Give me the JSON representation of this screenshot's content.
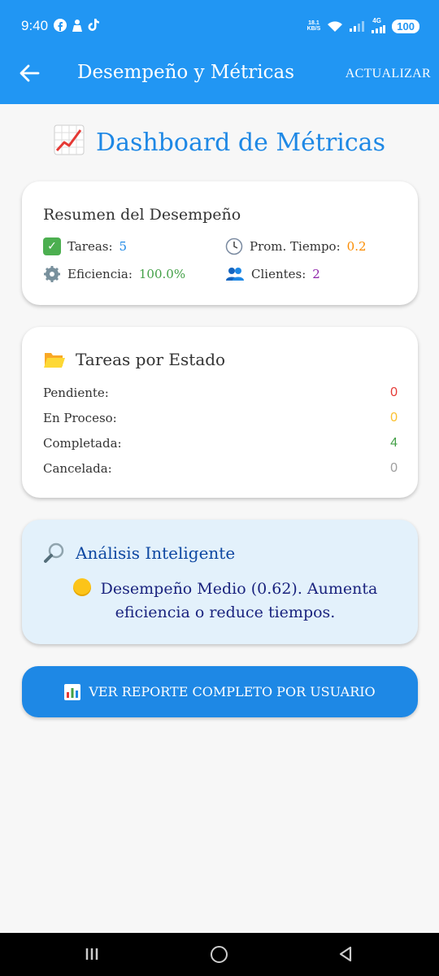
{
  "status_bar": {
    "time": "9:40",
    "speed_top": "18.1",
    "speed_bottom": "KB/S",
    "network": "4G",
    "battery": "100"
  },
  "appbar": {
    "title": "Desempeño y Métricas",
    "action": "ACTUALIZAR"
  },
  "header": {
    "emoji": "📈",
    "title": "Dashboard de Métricas"
  },
  "summary": {
    "title": "Resumen del Desempeño",
    "tareas_label": "Tareas:",
    "tareas_value": "5",
    "tiempo_label": "Prom. Tiempo:",
    "tiempo_value": "0.2",
    "eficiencia_label": "Eficiencia:",
    "eficiencia_value": "100.0%",
    "clientes_label": "Clientes:",
    "clientes_value": "2"
  },
  "status_card": {
    "title": "Tareas por Estado",
    "rows": [
      {
        "label": "Pendiente:",
        "value": "0",
        "color": "#e53935"
      },
      {
        "label": "En Proceso:",
        "value": "0",
        "color": "#fbc02d"
      },
      {
        "label": "Completada:",
        "value": "4",
        "color": "#43a047"
      },
      {
        "label": "Cancelada:",
        "value": "0",
        "color": "#9e9e9e"
      }
    ]
  },
  "analysis": {
    "title": "Análisis Inteligente",
    "text": "Desempeño Medio (0.62). Aumenta eficiencia o reduce tiempos."
  },
  "report_button": {
    "label": "VER REPORTE COMPLETO POR USUARIO"
  },
  "colors": {
    "primary": "#2196f3",
    "accent": "#1e88e5"
  }
}
